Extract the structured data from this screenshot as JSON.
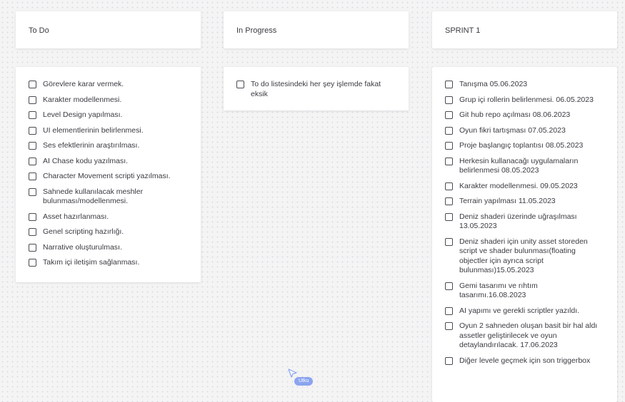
{
  "columns": [
    {
      "header": "To Do",
      "items": [
        "Görevlere karar vermek.",
        "Karakter modellenmesi.",
        "Level Design yapılması.",
        "UI elementlerinin belirlenmesi.",
        "Ses efektlerinin araştırılması.",
        "AI Chase kodu yazılması.",
        "Character Movement  scripti yazılması.",
        "Sahnede kullanılacak meshler bulunması/modellenmesi.",
        "Asset hazırlanması.",
        "Genel scripting hazırlığı.",
        "Narrative oluşturulması.",
        "Takım içi iletişim sağlanması."
      ]
    },
    {
      "header": "In Progress",
      "items": [
        "To do listesindeki her şey işlemde fakat eksik"
      ]
    },
    {
      "header": "SPRINT 1",
      "items": [
        "Tanışma 05.06.2023",
        "Grup içi rollerin belirlenmesi. 06.05.2023",
        "Git hub repo açılması 08.06.2023",
        "Oyun fikri tartışması 07.05.2023",
        "Proje başlangıç toplantısı 08.05.2023",
        "Herkesin kullanacağı uygulamaların belirlenmesi 08.05.2023",
        "Karakter modellenmesi. 09.05.2023",
        "Terrain yapılması 11.05.2023",
        "Deniz shaderi üzerinde uğraşılması 13.05.2023",
        "Deniz shaderi için unity asset storeden script ve shader bulunması(floating objectler için ayrıca script bulunması)15.05.2023",
        "Gemi tasarımı ve rıhtım tasarımı.16.08.2023",
        "AI yapımı ve gerekli scriptler yazıldı.",
        "Oyun 2 sahneden oluşan basit bir hal aldı assetler geliştirilecek ve oyun detaylandırılacak. 17.06.2023",
        "Diğer levele geçmek için son triggerbox"
      ]
    }
  ],
  "cursor": {
    "user_label": "Utku",
    "color": "#8aa4ef"
  }
}
